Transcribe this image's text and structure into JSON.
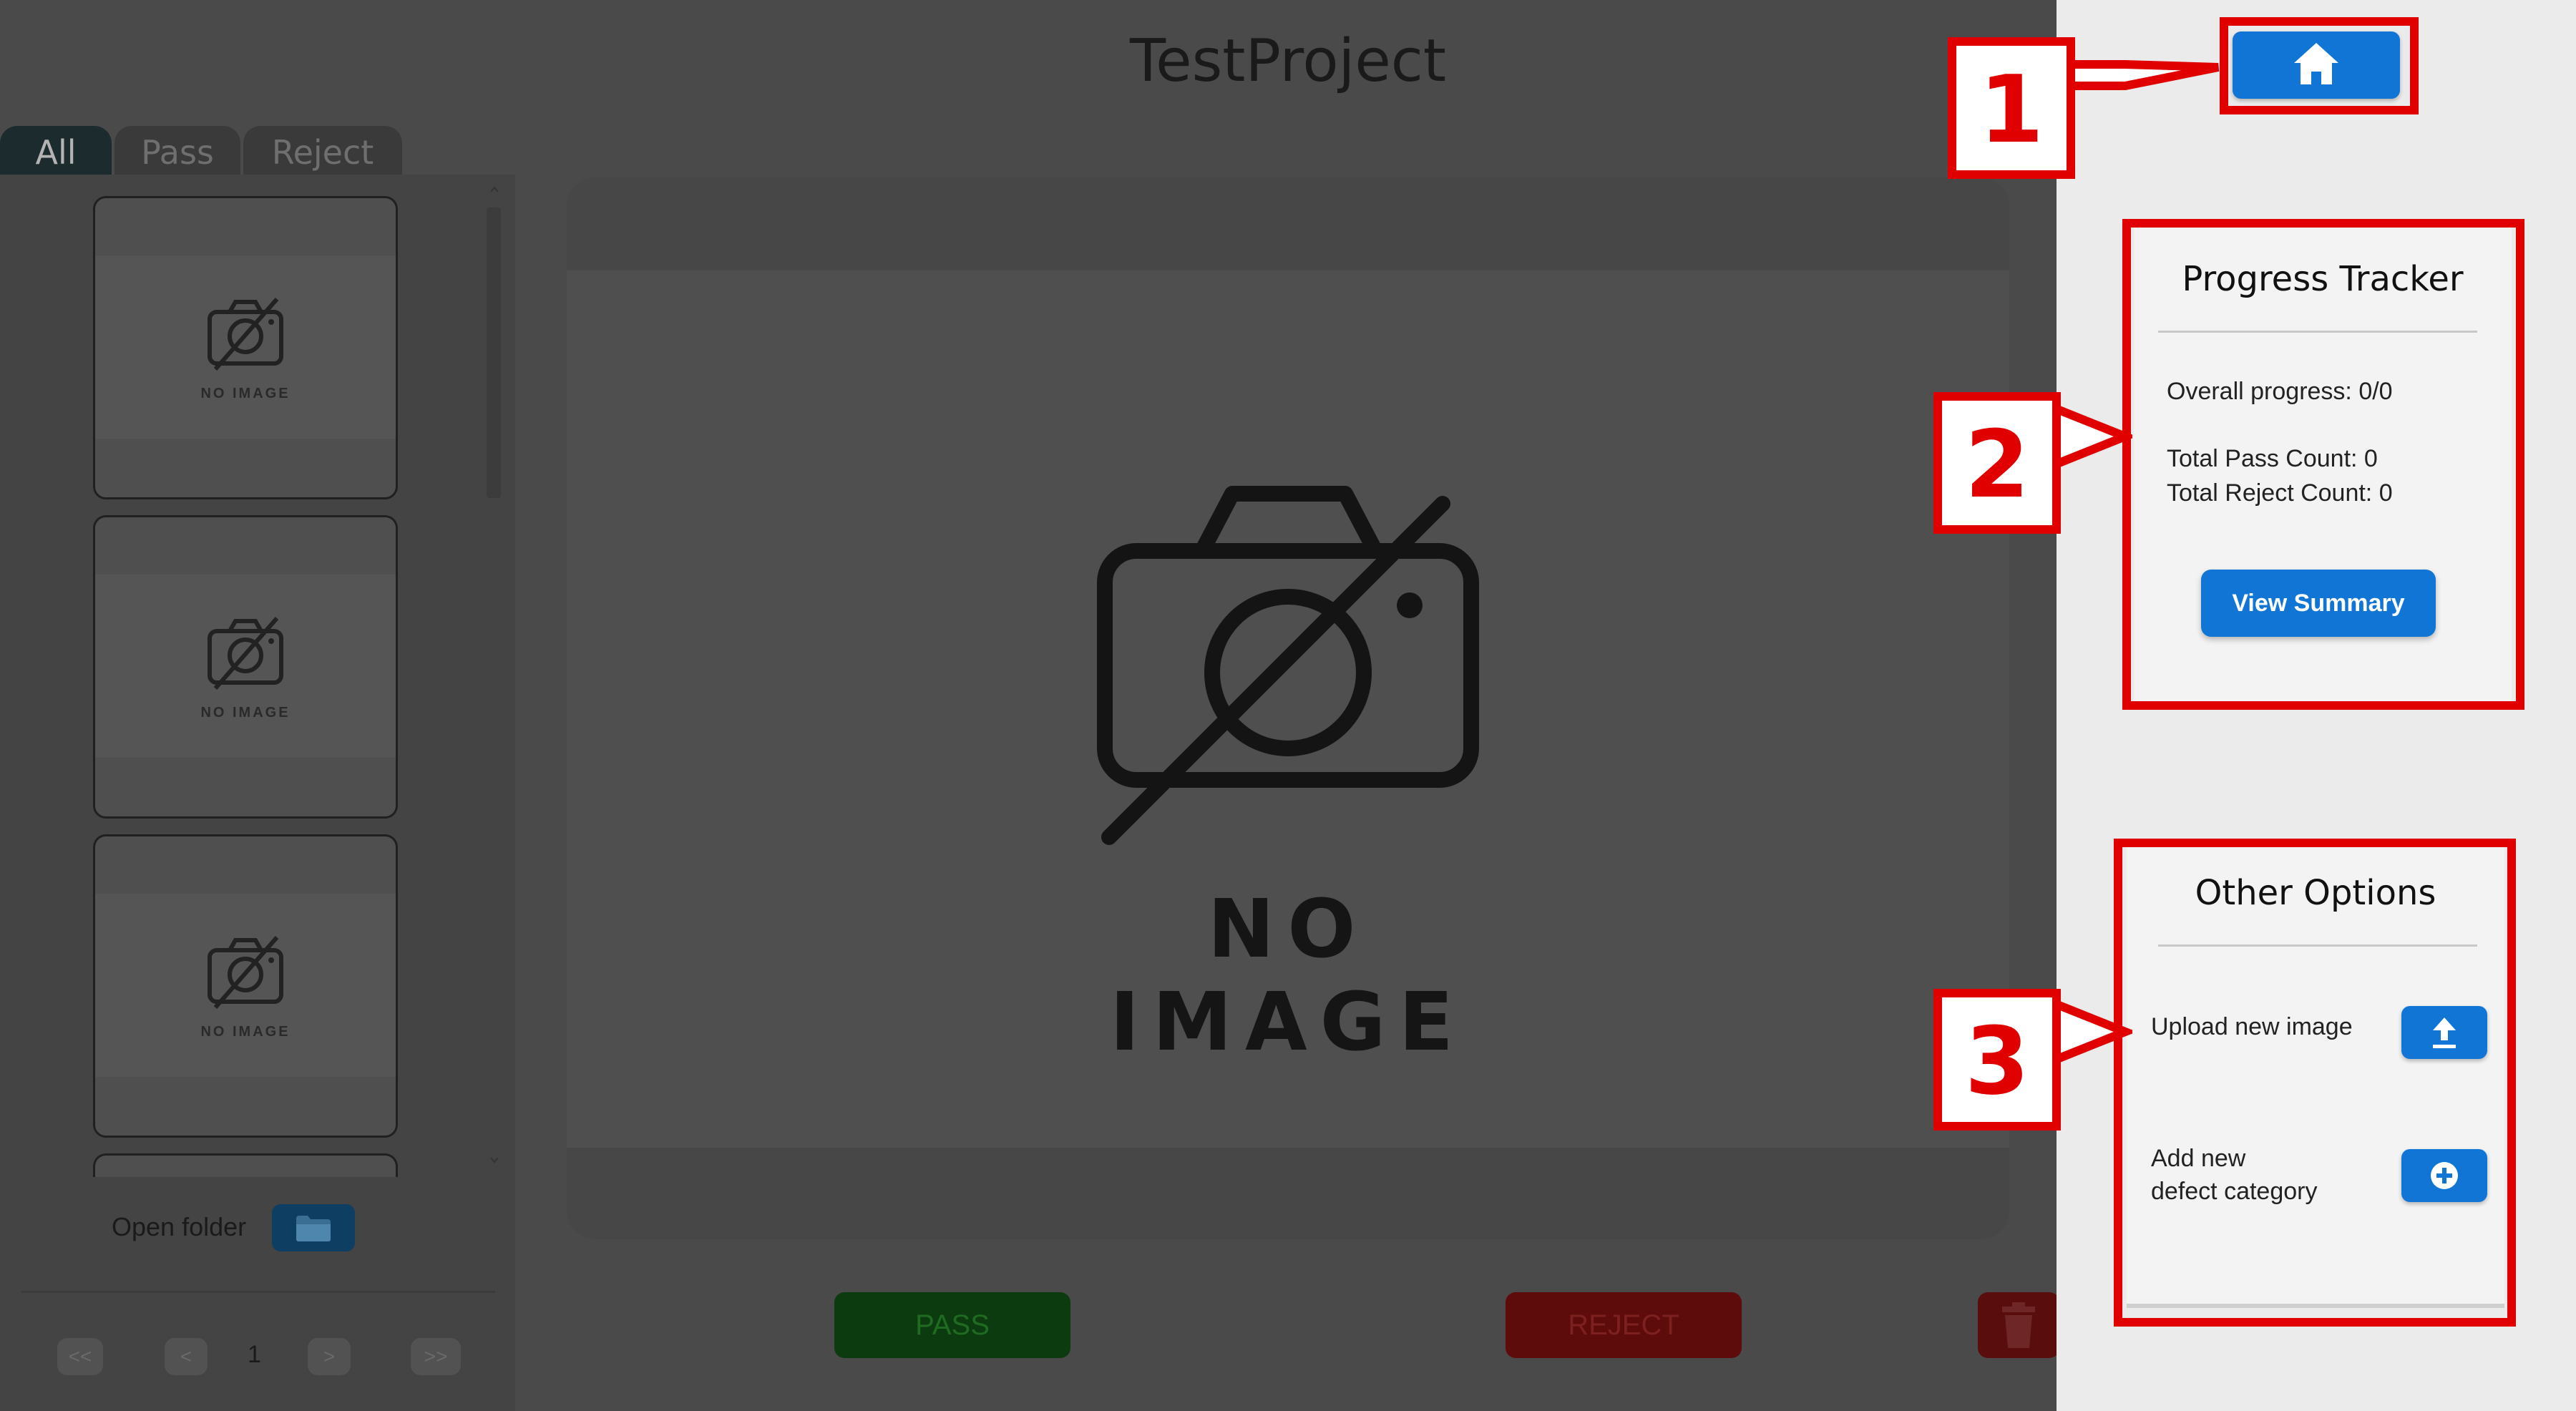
{
  "app": {
    "title": "TestProject",
    "tabs": [
      {
        "label": "All"
      },
      {
        "label": "Pass"
      },
      {
        "label": "Reject"
      }
    ],
    "thumbnails": [
      {
        "label": "NO IMAGE"
      },
      {
        "label": "NO IMAGE"
      },
      {
        "label": "NO IMAGE"
      }
    ],
    "open_folder_label": "Open folder",
    "pager": {
      "first": "<<",
      "prev": "<",
      "page": "1",
      "next": ">",
      "last": ">>"
    },
    "viewer": {
      "placeholder": "NO IMAGE"
    },
    "pass_label": "PASS",
    "reject_label": "REJECT"
  },
  "sidebar": {
    "progress_tracker": {
      "title": "Progress Tracker",
      "overall_progress": "Overall progress: 0/0",
      "total_pass": "Total Pass Count: 0",
      "total_reject": "Total Reject Count: 0",
      "view_summary_label": "View Summary"
    },
    "other_options": {
      "title": "Other Options",
      "upload_label": "Upload new image",
      "add_defect_line1": "Add new",
      "add_defect_line2": "defect category"
    }
  },
  "annotations": {
    "callouts": [
      "1",
      "2",
      "3"
    ]
  },
  "colors": {
    "accent": "#1175d6",
    "annotation": "#e00000",
    "pass_dim": "#0d3b10",
    "reject_dim": "#5d0b0b"
  },
  "icons": [
    "home-icon",
    "folder-icon",
    "no-image-camera-icon",
    "trash-icon",
    "upload-icon",
    "plus-circle-icon"
  ]
}
